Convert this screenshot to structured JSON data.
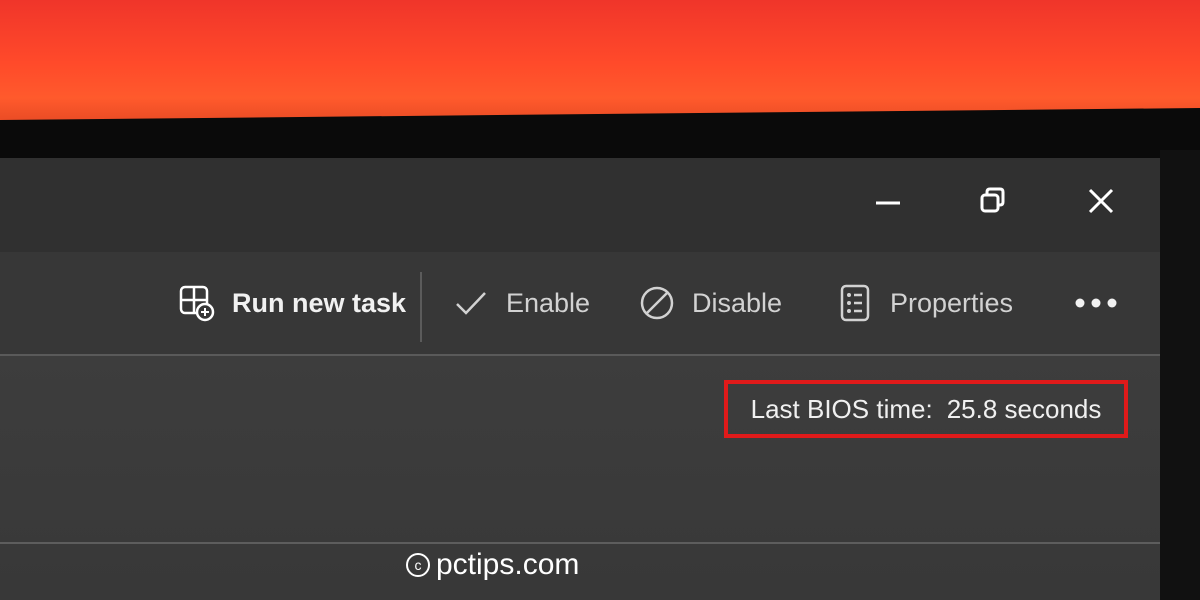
{
  "window_controls": {
    "minimize": "minimize-icon",
    "maximize": "restore-icon",
    "close": "close-icon"
  },
  "command_bar": {
    "run_new_task": "Run new task",
    "enable": "Enable",
    "disable": "Disable",
    "properties": "Properties",
    "more": "more-icon"
  },
  "details": {
    "bios_label": "Last BIOS time:",
    "bios_value": "25.8 seconds"
  },
  "colors": {
    "highlight_box": "#e01a1a",
    "background_wall": "#ff4a2a"
  },
  "watermark": {
    "symbol": "c",
    "text": "pctips.com"
  }
}
